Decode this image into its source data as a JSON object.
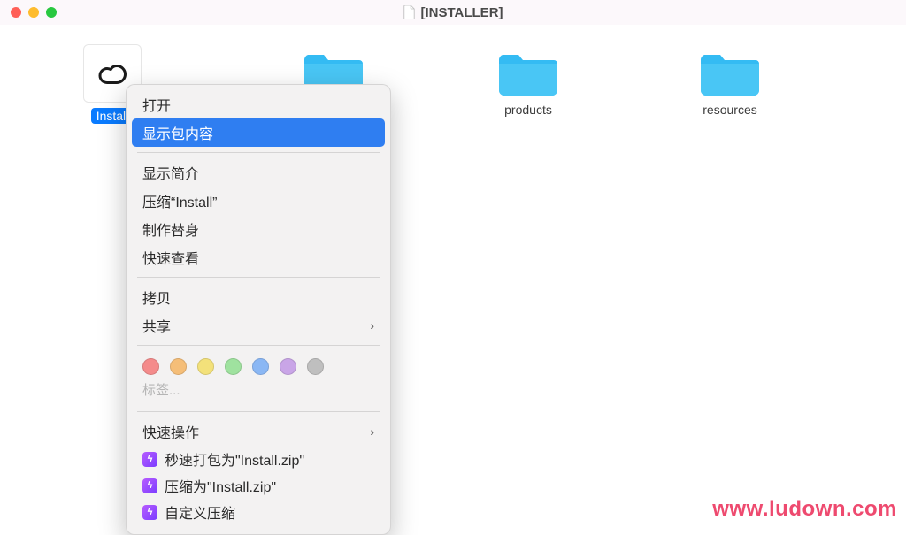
{
  "window": {
    "title": "[INSTALLER]"
  },
  "desktop_items": {
    "install": {
      "label": "Install"
    },
    "folder_cut": {
      "label": ""
    },
    "products": {
      "label": "products"
    },
    "resources": {
      "label": "resources"
    }
  },
  "context_menu": {
    "open": "打开",
    "show_package_contents": "显示包内容",
    "get_info": "显示简介",
    "compress": "压缩“Install”",
    "make_alias": "制作替身",
    "quick_look": "快速查看",
    "copy": "拷贝",
    "share": "共享",
    "tags_label": "标签...",
    "tag_colors": [
      "#f48b8b",
      "#f5be78",
      "#f3e17a",
      "#9fe29f",
      "#8ab7f4",
      "#c9a5e7",
      "#bfbfbf"
    ],
    "quick_actions_header": "快速操作",
    "quick_actions": [
      {
        "label": "秒速打包为\"Install.zip\""
      },
      {
        "label": "压缩为\"Install.zip\""
      },
      {
        "label": "自定义压缩"
      }
    ]
  },
  "watermark": "www.ludown.com"
}
